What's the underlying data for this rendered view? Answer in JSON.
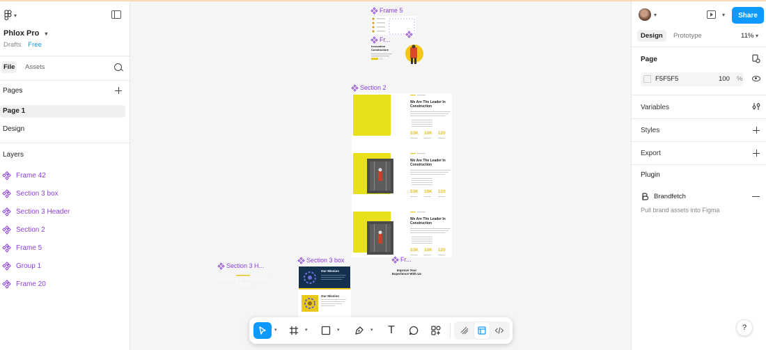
{
  "app": {
    "file_name": "Phlox Pro",
    "location": "Drafts",
    "plan": "Free"
  },
  "left_panel": {
    "tabs": [
      "File",
      "Assets"
    ],
    "pages_title": "Pages",
    "pages": [
      "Page 1",
      "Design"
    ],
    "layers_title": "Layers",
    "layers": [
      "Frame 42",
      "Section 3 box",
      "Section 3 Header",
      "Section 2",
      "Frame 5",
      "Group 1",
      "Frame 20"
    ]
  },
  "canvas": {
    "frame_labels": {
      "frame5": "Frame 5",
      "fr_small": "Fr...",
      "section2": "Section 2",
      "section3box": "Section 3 box",
      "section3h": "Section 3 H...",
      "fr_bottom": "Fr..."
    },
    "section2": {
      "heading": "We Are The Leader In Construction",
      "stats": [
        "53K",
        "10K",
        "120"
      ]
    },
    "frame5_heading": "Innovation Constructure",
    "mission": "Our Mission",
    "improve": "Improve Your Experience With Us"
  },
  "right_panel": {
    "share_label": "Share",
    "tabs": [
      "Design",
      "Prototype"
    ],
    "zoom": "11%",
    "page_title": "Page",
    "bg_hex": "F5F5F5",
    "bg_opacity": "100",
    "pct": "%",
    "variables": "Variables",
    "styles": "Styles",
    "export": "Export",
    "plugin_title": "Plugin",
    "plugin_name": "Brandfetch",
    "plugin_desc": "Pull brand assets into Figma",
    "help": "?"
  },
  "toolbar": {
    "tools": [
      "move-tool",
      "frame-tool",
      "shape-tool",
      "pen-tool",
      "text-tool",
      "comment-tool",
      "actions-tool",
      "draw-mode",
      "design-mode",
      "dev-mode"
    ],
    "text_glyph": "T"
  },
  "colors": {
    "accent": "#0d99ff",
    "component": "#8b3fdb",
    "canvas_bg": "#F5F5F5",
    "brand_yellow": "#e8e01a"
  }
}
